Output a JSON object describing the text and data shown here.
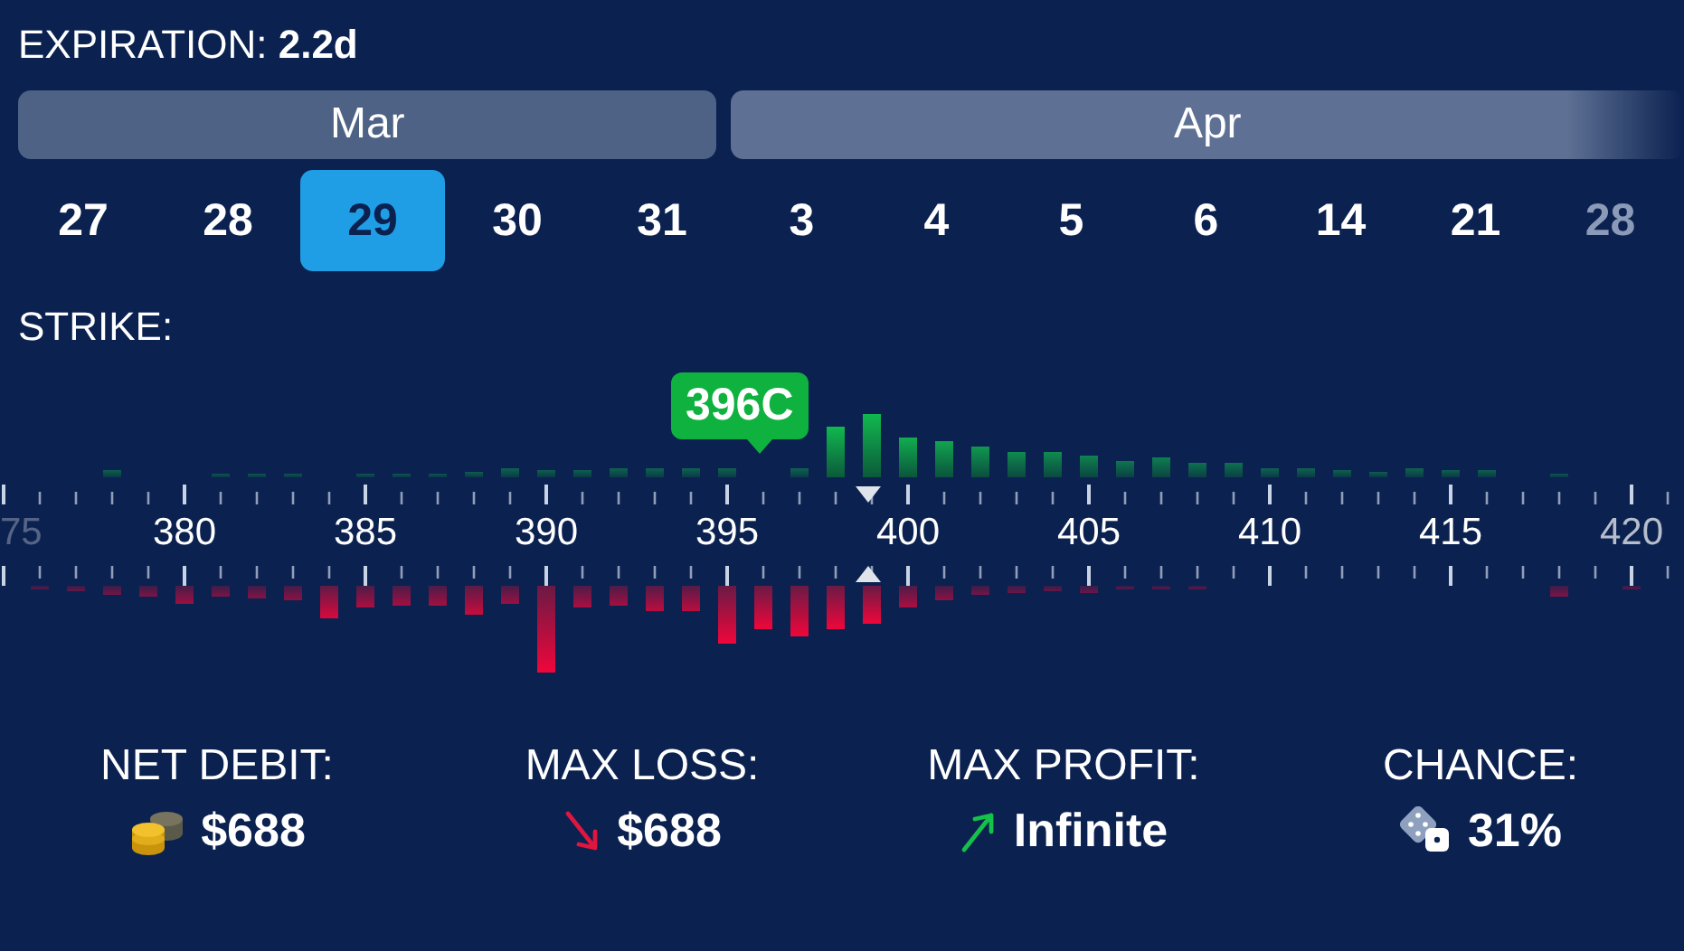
{
  "expiration": {
    "label": "EXPIRATION:",
    "value": "2.2d"
  },
  "months": [
    {
      "label": "Mar"
    },
    {
      "label": "Apr"
    }
  ],
  "dates": [
    {
      "label": "27",
      "selected": false,
      "faded": false
    },
    {
      "label": "28",
      "selected": false,
      "faded": false
    },
    {
      "label": "29",
      "selected": true,
      "faded": false
    },
    {
      "label": "30",
      "selected": false,
      "faded": false
    },
    {
      "label": "31",
      "selected": false,
      "faded": false
    },
    {
      "label": "3",
      "selected": false,
      "faded": false
    },
    {
      "label": "4",
      "selected": false,
      "faded": false
    },
    {
      "label": "5",
      "selected": false,
      "faded": false
    },
    {
      "label": "6",
      "selected": false,
      "faded": false
    },
    {
      "label": "14",
      "selected": false,
      "faded": false
    },
    {
      "label": "21",
      "selected": false,
      "faded": false
    },
    {
      "label": "28",
      "selected": false,
      "faded": true
    }
  ],
  "strike": {
    "label": "STRIKE:",
    "tooltip": "396C",
    "labels": [
      {
        "label": "75",
        "faded": true
      },
      {
        "label": "380",
        "faded": false
      },
      {
        "label": "385",
        "faded": false
      },
      {
        "label": "390",
        "faded": false
      },
      {
        "label": "395",
        "faded": false
      },
      {
        "label": "400",
        "faded": false
      },
      {
        "label": "405",
        "faded": false
      },
      {
        "label": "410",
        "faded": false
      },
      {
        "label": "415",
        "faded": false
      },
      {
        "label": "420",
        "faded": true
      }
    ]
  },
  "stats": [
    {
      "label": "NET DEBIT:",
      "value": "$688",
      "kind": "coins"
    },
    {
      "label": "MAX LOSS:",
      "value": "$688",
      "kind": "down"
    },
    {
      "label": "MAX PROFIT:",
      "value": "Infinite",
      "kind": "up"
    },
    {
      "label": "CHANCE:",
      "value": "31%",
      "kind": "dice"
    }
  ]
}
